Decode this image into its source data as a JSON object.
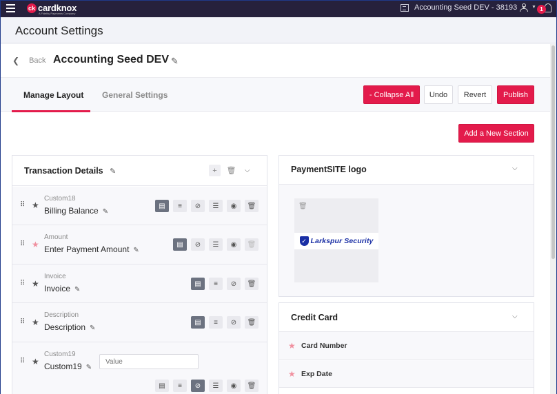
{
  "topbar": {
    "brand": "cardknox",
    "brand_sub": "A Fidelity Payments Company",
    "account": "Accounting Seed DEV - 38193",
    "notifications": "1",
    "icons": [
      "menu-icon",
      "building-icon",
      "user-icon",
      "bell-icon"
    ]
  },
  "page": {
    "title": "Account Settings"
  },
  "header": {
    "back_label": "Back",
    "site_title": "Accounting Seed DEV"
  },
  "tabs": [
    {
      "label": "Manage Layout",
      "active": true
    },
    {
      "label": "General Settings",
      "active": false
    }
  ],
  "toolbar": {
    "collapse_all": "- Collapse All",
    "undo": "Undo",
    "revert": "Revert",
    "publish": "Publish",
    "add_section": "Add a New Section"
  },
  "transaction_details": {
    "title": "Transaction Details",
    "fields": [
      {
        "meta": "Custom18",
        "label": "Billing Balance",
        "required": false
      },
      {
        "meta": "Amount",
        "label": "Enter Payment Amount",
        "required": true
      },
      {
        "meta": "Invoice",
        "label": "Invoice",
        "required": false
      },
      {
        "meta": "Description",
        "label": "Description",
        "required": false
      },
      {
        "meta": "Custom19",
        "label": "Custom19",
        "required": false,
        "placeholder": "Value"
      }
    ]
  },
  "logo_section": {
    "title": "PaymentSITE logo",
    "logo_text": "Larkspur Security"
  },
  "credit_card": {
    "title": "Credit Card",
    "fields": [
      {
        "label": "Card Number"
      },
      {
        "label": "Exp Date"
      }
    ]
  },
  "colors": {
    "accent": "#e31b4b",
    "topbar": "#26213c",
    "brand_blue": "#1a2fa5"
  }
}
